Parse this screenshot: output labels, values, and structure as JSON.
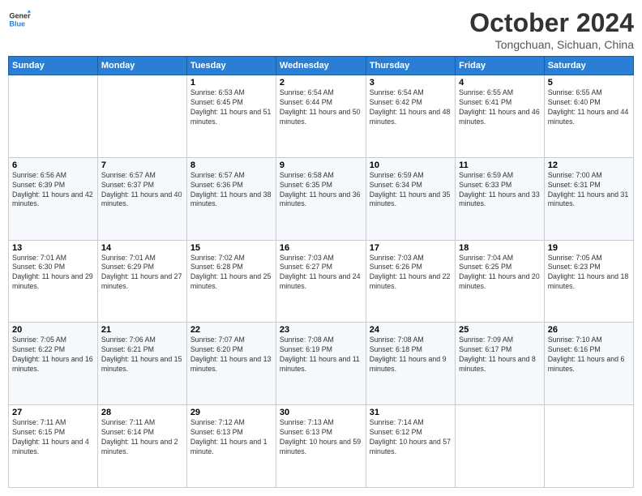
{
  "header": {
    "logo_general": "General",
    "logo_blue": "Blue",
    "month_title": "October 2024",
    "location": "Tongchuan, Sichuan, China"
  },
  "weekdays": [
    "Sunday",
    "Monday",
    "Tuesday",
    "Wednesday",
    "Thursday",
    "Friday",
    "Saturday"
  ],
  "weeks": [
    [
      {
        "day": "",
        "sunrise": "",
        "sunset": "",
        "daylight": ""
      },
      {
        "day": "",
        "sunrise": "",
        "sunset": "",
        "daylight": ""
      },
      {
        "day": "1",
        "sunrise": "Sunrise: 6:53 AM",
        "sunset": "Sunset: 6:45 PM",
        "daylight": "Daylight: 11 hours and 51 minutes."
      },
      {
        "day": "2",
        "sunrise": "Sunrise: 6:54 AM",
        "sunset": "Sunset: 6:44 PM",
        "daylight": "Daylight: 11 hours and 50 minutes."
      },
      {
        "day": "3",
        "sunrise": "Sunrise: 6:54 AM",
        "sunset": "Sunset: 6:42 PM",
        "daylight": "Daylight: 11 hours and 48 minutes."
      },
      {
        "day": "4",
        "sunrise": "Sunrise: 6:55 AM",
        "sunset": "Sunset: 6:41 PM",
        "daylight": "Daylight: 11 hours and 46 minutes."
      },
      {
        "day": "5",
        "sunrise": "Sunrise: 6:55 AM",
        "sunset": "Sunset: 6:40 PM",
        "daylight": "Daylight: 11 hours and 44 minutes."
      }
    ],
    [
      {
        "day": "6",
        "sunrise": "Sunrise: 6:56 AM",
        "sunset": "Sunset: 6:39 PM",
        "daylight": "Daylight: 11 hours and 42 minutes."
      },
      {
        "day": "7",
        "sunrise": "Sunrise: 6:57 AM",
        "sunset": "Sunset: 6:37 PM",
        "daylight": "Daylight: 11 hours and 40 minutes."
      },
      {
        "day": "8",
        "sunrise": "Sunrise: 6:57 AM",
        "sunset": "Sunset: 6:36 PM",
        "daylight": "Daylight: 11 hours and 38 minutes."
      },
      {
        "day": "9",
        "sunrise": "Sunrise: 6:58 AM",
        "sunset": "Sunset: 6:35 PM",
        "daylight": "Daylight: 11 hours and 36 minutes."
      },
      {
        "day": "10",
        "sunrise": "Sunrise: 6:59 AM",
        "sunset": "Sunset: 6:34 PM",
        "daylight": "Daylight: 11 hours and 35 minutes."
      },
      {
        "day": "11",
        "sunrise": "Sunrise: 6:59 AM",
        "sunset": "Sunset: 6:33 PM",
        "daylight": "Daylight: 11 hours and 33 minutes."
      },
      {
        "day": "12",
        "sunrise": "Sunrise: 7:00 AM",
        "sunset": "Sunset: 6:31 PM",
        "daylight": "Daylight: 11 hours and 31 minutes."
      }
    ],
    [
      {
        "day": "13",
        "sunrise": "Sunrise: 7:01 AM",
        "sunset": "Sunset: 6:30 PM",
        "daylight": "Daylight: 11 hours and 29 minutes."
      },
      {
        "day": "14",
        "sunrise": "Sunrise: 7:01 AM",
        "sunset": "Sunset: 6:29 PM",
        "daylight": "Daylight: 11 hours and 27 minutes."
      },
      {
        "day": "15",
        "sunrise": "Sunrise: 7:02 AM",
        "sunset": "Sunset: 6:28 PM",
        "daylight": "Daylight: 11 hours and 25 minutes."
      },
      {
        "day": "16",
        "sunrise": "Sunrise: 7:03 AM",
        "sunset": "Sunset: 6:27 PM",
        "daylight": "Daylight: 11 hours and 24 minutes."
      },
      {
        "day": "17",
        "sunrise": "Sunrise: 7:03 AM",
        "sunset": "Sunset: 6:26 PM",
        "daylight": "Daylight: 11 hours and 22 minutes."
      },
      {
        "day": "18",
        "sunrise": "Sunrise: 7:04 AM",
        "sunset": "Sunset: 6:25 PM",
        "daylight": "Daylight: 11 hours and 20 minutes."
      },
      {
        "day": "19",
        "sunrise": "Sunrise: 7:05 AM",
        "sunset": "Sunset: 6:23 PM",
        "daylight": "Daylight: 11 hours and 18 minutes."
      }
    ],
    [
      {
        "day": "20",
        "sunrise": "Sunrise: 7:05 AM",
        "sunset": "Sunset: 6:22 PM",
        "daylight": "Daylight: 11 hours and 16 minutes."
      },
      {
        "day": "21",
        "sunrise": "Sunrise: 7:06 AM",
        "sunset": "Sunset: 6:21 PM",
        "daylight": "Daylight: 11 hours and 15 minutes."
      },
      {
        "day": "22",
        "sunrise": "Sunrise: 7:07 AM",
        "sunset": "Sunset: 6:20 PM",
        "daylight": "Daylight: 11 hours and 13 minutes."
      },
      {
        "day": "23",
        "sunrise": "Sunrise: 7:08 AM",
        "sunset": "Sunset: 6:19 PM",
        "daylight": "Daylight: 11 hours and 11 minutes."
      },
      {
        "day": "24",
        "sunrise": "Sunrise: 7:08 AM",
        "sunset": "Sunset: 6:18 PM",
        "daylight": "Daylight: 11 hours and 9 minutes."
      },
      {
        "day": "25",
        "sunrise": "Sunrise: 7:09 AM",
        "sunset": "Sunset: 6:17 PM",
        "daylight": "Daylight: 11 hours and 8 minutes."
      },
      {
        "day": "26",
        "sunrise": "Sunrise: 7:10 AM",
        "sunset": "Sunset: 6:16 PM",
        "daylight": "Daylight: 11 hours and 6 minutes."
      }
    ],
    [
      {
        "day": "27",
        "sunrise": "Sunrise: 7:11 AM",
        "sunset": "Sunset: 6:15 PM",
        "daylight": "Daylight: 11 hours and 4 minutes."
      },
      {
        "day": "28",
        "sunrise": "Sunrise: 7:11 AM",
        "sunset": "Sunset: 6:14 PM",
        "daylight": "Daylight: 11 hours and 2 minutes."
      },
      {
        "day": "29",
        "sunrise": "Sunrise: 7:12 AM",
        "sunset": "Sunset: 6:13 PM",
        "daylight": "Daylight: 11 hours and 1 minute."
      },
      {
        "day": "30",
        "sunrise": "Sunrise: 7:13 AM",
        "sunset": "Sunset: 6:13 PM",
        "daylight": "Daylight: 10 hours and 59 minutes."
      },
      {
        "day": "31",
        "sunrise": "Sunrise: 7:14 AM",
        "sunset": "Sunset: 6:12 PM",
        "daylight": "Daylight: 10 hours and 57 minutes."
      },
      {
        "day": "",
        "sunrise": "",
        "sunset": "",
        "daylight": ""
      },
      {
        "day": "",
        "sunrise": "",
        "sunset": "",
        "daylight": ""
      }
    ]
  ]
}
